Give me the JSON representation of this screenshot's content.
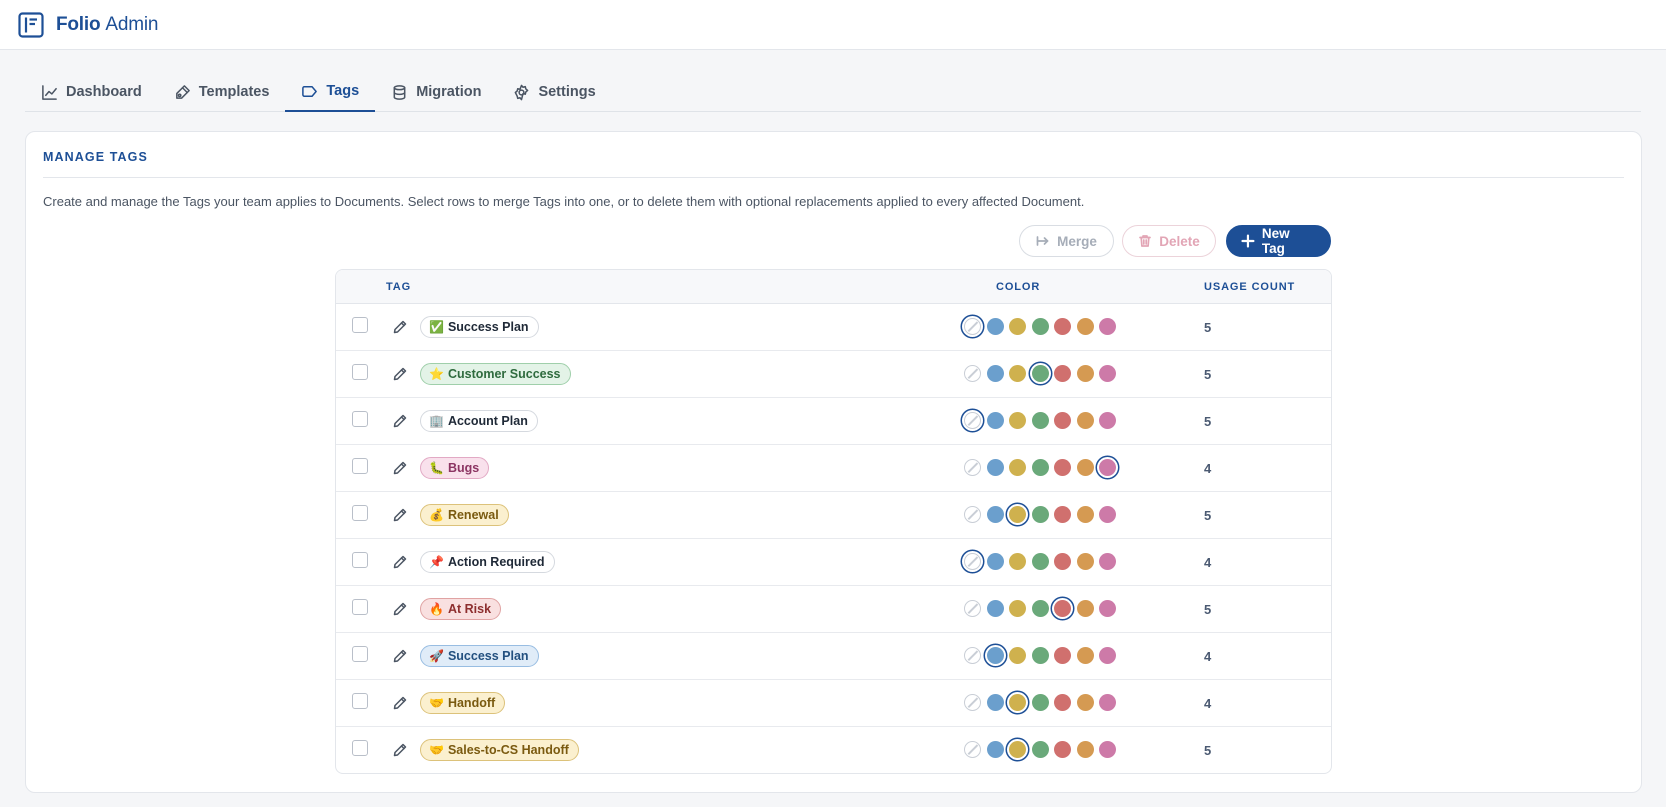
{
  "app": {
    "brand_bold": "Folio",
    "brand_rest": "Admin"
  },
  "tabs": [
    {
      "label": "Dashboard",
      "icon": "chart-line-icon",
      "active": false
    },
    {
      "label": "Templates",
      "icon": "template-icon",
      "active": false
    },
    {
      "label": "Tags",
      "icon": "tag-icon",
      "active": true
    },
    {
      "label": "Migration",
      "icon": "database-icon",
      "active": false
    },
    {
      "label": "Settings",
      "icon": "gear-icon",
      "active": false
    }
  ],
  "panel": {
    "title": "MANAGE TAGS",
    "description": "Create and manage the Tags your team applies to Documents. Select rows to merge Tags into one, or to delete them with optional replacements applied to every affected Document."
  },
  "actions": {
    "merge_label": "Merge",
    "delete_label": "Delete",
    "new_label": "New Tag"
  },
  "table": {
    "headers": {
      "tag": "TAG",
      "color": "COLOR",
      "usage": "USAGE COUNT"
    },
    "palette": [
      {
        "name": "none",
        "hex": "#ffffff"
      },
      {
        "name": "blue",
        "hex": "#6b9fcd"
      },
      {
        "name": "yellow",
        "hex": "#cfb14e"
      },
      {
        "name": "green",
        "hex": "#6aa97a"
      },
      {
        "name": "red",
        "hex": "#d0706e"
      },
      {
        "name": "orange",
        "hex": "#d59a52"
      },
      {
        "name": "pink",
        "hex": "#cd7aa8"
      }
    ],
    "rows": [
      {
        "emoji": "✅",
        "name": "Success Plan",
        "color": "none",
        "usage": "5"
      },
      {
        "emoji": "⭐",
        "name": "Customer Success",
        "color": "green",
        "usage": "5"
      },
      {
        "emoji": "🏢",
        "name": "Account Plan",
        "color": "none",
        "usage": "5"
      },
      {
        "emoji": "🐛",
        "name": "Bugs",
        "color": "pink",
        "usage": "4"
      },
      {
        "emoji": "💰",
        "name": "Renewal",
        "color": "yellow",
        "usage": "5"
      },
      {
        "emoji": "📌",
        "name": "Action Required",
        "color": "none",
        "usage": "4"
      },
      {
        "emoji": "🔥",
        "name": "At Risk",
        "color": "red",
        "usage": "5"
      },
      {
        "emoji": "🚀",
        "name": "Success Plan",
        "color": "blue",
        "usage": "4"
      },
      {
        "emoji": "🤝",
        "name": "Handoff",
        "color": "yellow",
        "usage": "4"
      },
      {
        "emoji": "🤝",
        "name": "Sales-to-CS Handoff",
        "color": "yellow",
        "usage": "5"
      }
    ]
  }
}
